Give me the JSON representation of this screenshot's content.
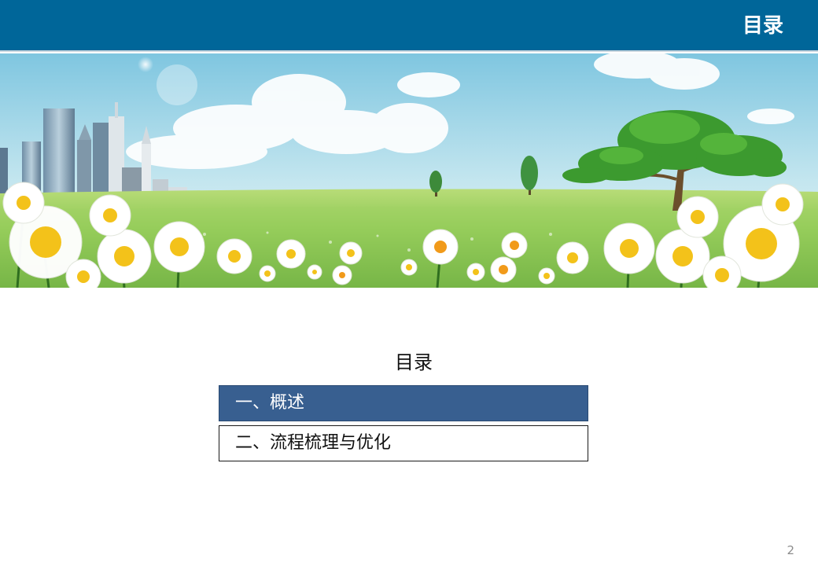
{
  "header": {
    "title": "目录",
    "background_color": "#006699"
  },
  "banner": {
    "scene": "city-skyline-meadow-daisies-tree"
  },
  "toc": {
    "heading": "目录",
    "items": [
      {
        "label": "一、概述",
        "active": true,
        "color": "#385f90"
      },
      {
        "label": "二、流程梳理与优化",
        "active": false
      }
    ]
  },
  "footer": {
    "page_number": "2"
  }
}
